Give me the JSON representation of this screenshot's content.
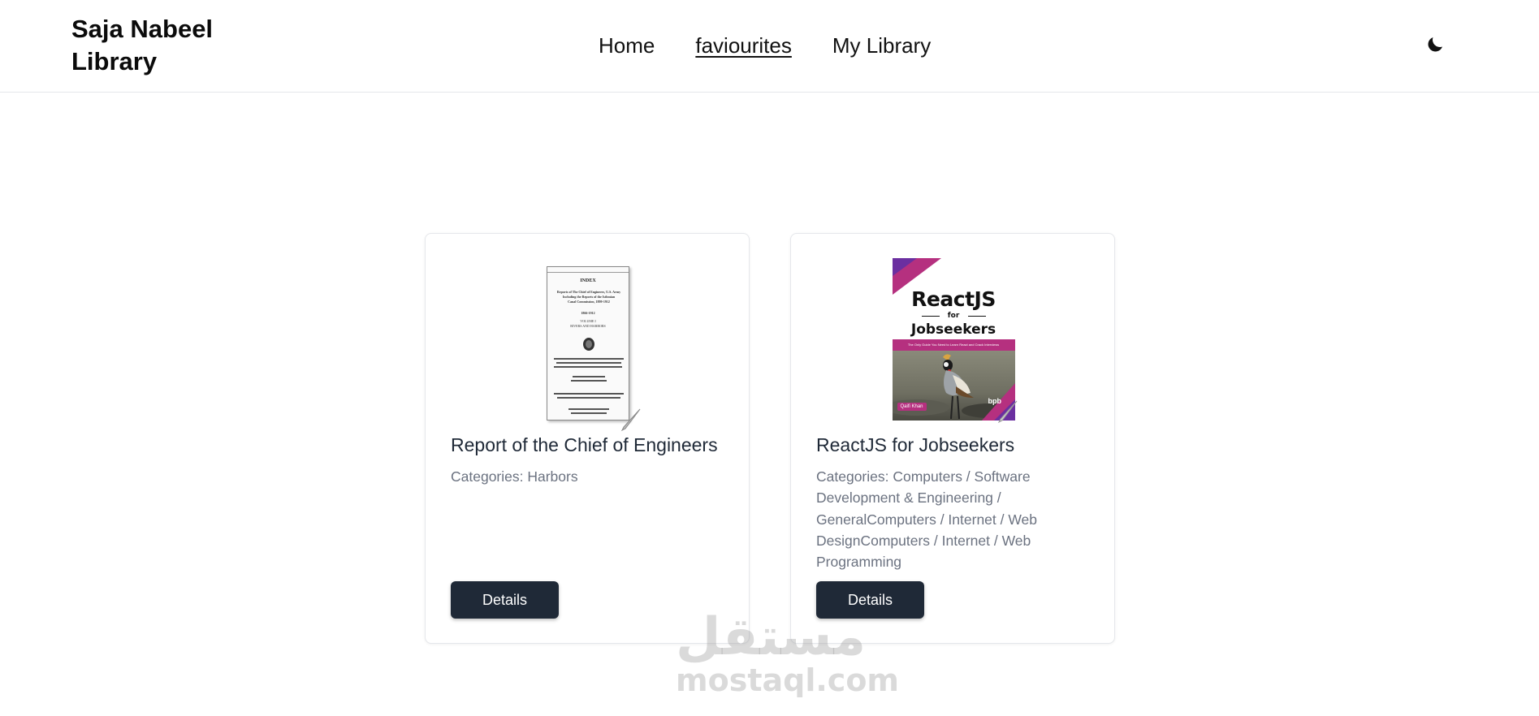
{
  "header": {
    "brand": "Saja Nabeel Library",
    "nav": [
      {
        "label": "Home"
      },
      {
        "label": "faviourites"
      },
      {
        "label": "My Library"
      }
    ],
    "theme_icon": "moon-icon"
  },
  "cards": [
    {
      "title": "Report of the Chief of Engineers",
      "categories": "Categories: Harbors",
      "button": "Details",
      "cover": {
        "lines": [
          "INDEX",
          "Reports of The Chief of Engineers, U.S. Army",
          "Including the Reports of the Isthmian",
          "Canal Commission, 1899-1912",
          "1866-1912",
          "VOLUME I",
          "RIVERS AND HARBORS"
        ]
      }
    },
    {
      "title": "ReactJS for Jobseekers",
      "categories": "Categories: Computers / Software Development & Engineering / GeneralComputers / Internet / Web DesignComputers / Internet / Web Programming",
      "button": "Details",
      "cover": {
        "title_line1": "ReactJS",
        "title_line2": "for",
        "title_line3": "Jobseekers",
        "tagline": "The Only Guide You Need to Learn React and Crack Interviews",
        "author": "Qaifi Khan",
        "publisher": "bpb"
      }
    }
  ],
  "watermark": {
    "arabic": "مستقل",
    "latin": "mostaql.com"
  },
  "colors": {
    "button_bg": "#1f2937",
    "cover_magenta": "#b5307f",
    "cover_purple": "#6b2fa0"
  }
}
